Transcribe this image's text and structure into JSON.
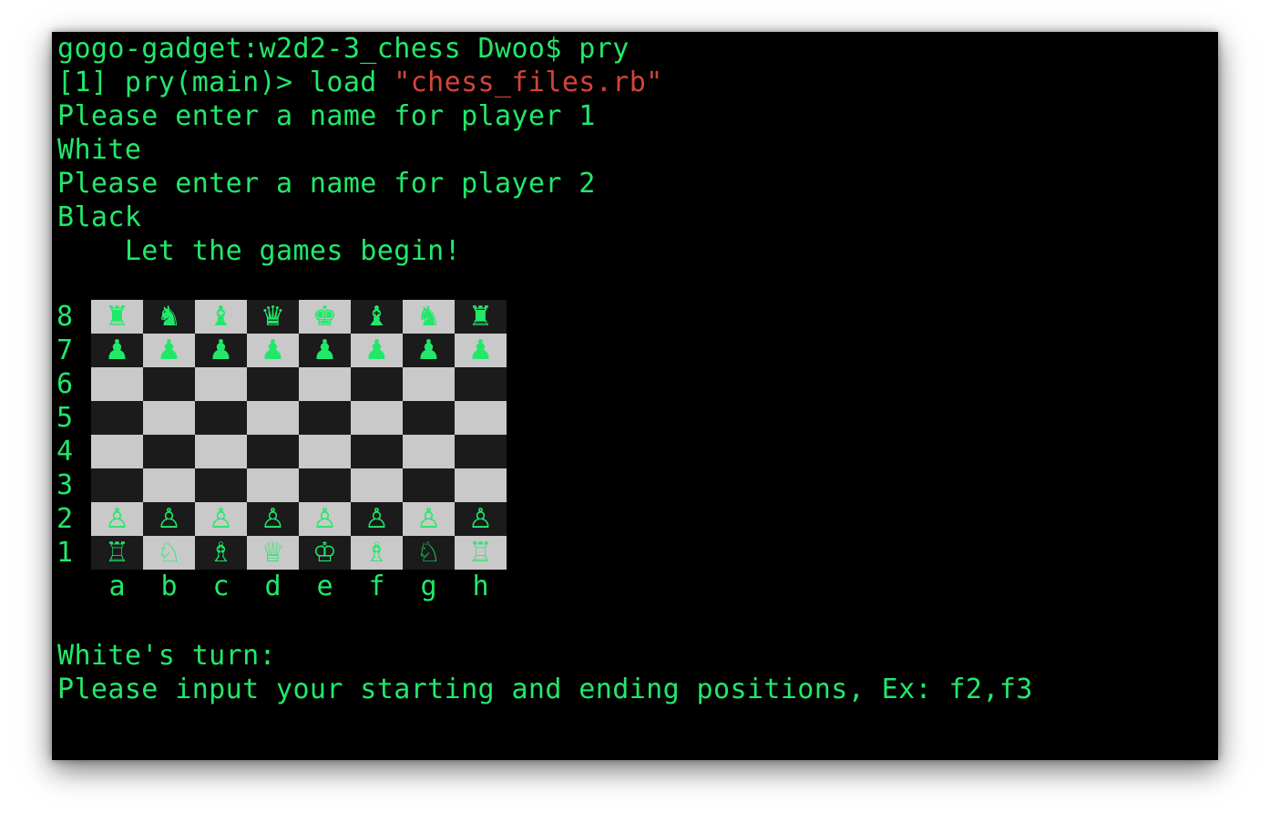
{
  "terminal": {
    "lines": [
      {
        "text": "gogo-gadget:w2d2-3_chess Dwoo$ pry"
      },
      {
        "prefix": "[1] pry(main)> load ",
        "string": "\"chess_files.rb\""
      },
      {
        "text": "Please enter a name for player 1"
      },
      {
        "text": "White"
      },
      {
        "text": "Please enter a name for player 2"
      },
      {
        "text": "Black"
      },
      {
        "text": "    Let the games begin!"
      }
    ],
    "turn_line": "White's turn:",
    "prompt_line": "Please input your starting and ending positions, Ex: f2,f3"
  },
  "board": {
    "ranks": [
      "8",
      "7",
      "6",
      "5",
      "4",
      "3",
      "2",
      "1"
    ],
    "files": [
      "a",
      "b",
      "c",
      "d",
      "e",
      "f",
      "g",
      "h"
    ],
    "rows": [
      [
        "♜",
        "♞",
        "♝",
        "♛",
        "♚",
        "♝",
        "♞",
        "♜"
      ],
      [
        "♟",
        "♟",
        "♟",
        "♟",
        "♟",
        "♟",
        "♟",
        "♟"
      ],
      [
        "",
        "",
        "",
        "",
        "",
        "",
        "",
        ""
      ],
      [
        "",
        "",
        "",
        "",
        "",
        "",
        "",
        ""
      ],
      [
        "",
        "",
        "",
        "",
        "",
        "",
        "",
        ""
      ],
      [
        "",
        "",
        "",
        "",
        "",
        "",
        "",
        ""
      ],
      [
        "♙",
        "♙",
        "♙",
        "♙",
        "♙",
        "♙",
        "♙",
        "♙"
      ],
      [
        "♖",
        "♘",
        "♗",
        "♕",
        "♔",
        "♗",
        "♘",
        "♖"
      ]
    ],
    "piece_color": "#22e86a",
    "light_square": "#c9c9c9",
    "dark_square": "#1b1b1b"
  },
  "colors": {
    "background": "#000000",
    "text": "#22e86a",
    "string": "#d2443b"
  }
}
